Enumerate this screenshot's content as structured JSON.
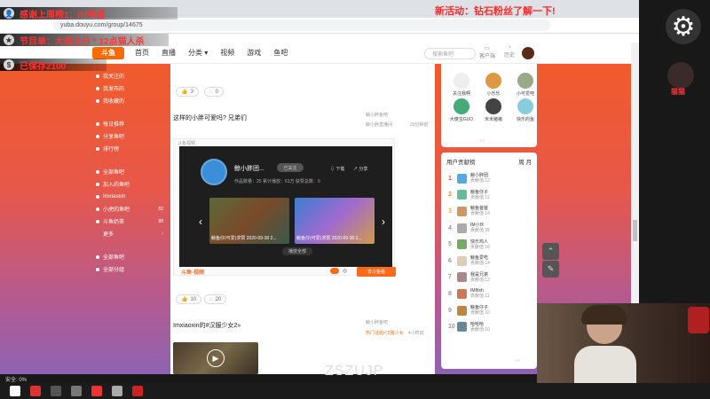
{
  "overlay": {
    "line1": "感谢上周榜1：IM希望",
    "line2": "节目单：大佬上分 * 12点猫人杀",
    "line3": "已保存2100",
    "activity": "新活动：钻石粉丝了解一下!",
    "right_label": "猫猫"
  },
  "browser": {
    "url": "yuba.douyu.com/group/14675"
  },
  "site": {
    "logo": "斗鱼",
    "nav": [
      "首页",
      "直播",
      "分类 ▾",
      "视频",
      "游戏",
      "鱼吧"
    ],
    "search_placeholder": "搜索鱼吧",
    "hdr_icons": [
      "客户端",
      "历史"
    ]
  },
  "leftnav": {
    "items": [
      "我关注的",
      "我发布的",
      "我收藏的"
    ],
    "items2": [
      "每日推荐",
      "分享鱼吧",
      "排行榜"
    ],
    "items3": [
      "全部鱼吧",
      "加入的鱼吧"
    ],
    "sub": [
      {
        "label": "Imxiaoxin",
        "num": ""
      },
      {
        "label": "小虎的鱼吧",
        "num": "82"
      },
      {
        "label": "斗鱼奶茶",
        "num": "88"
      },
      {
        "label": "更多",
        "num": ""
      }
    ],
    "items4": [
      "全部鱼吧",
      "全部分组"
    ]
  },
  "feed": {
    "like_count": "3",
    "comment_count": "0",
    "post1_title": "这样的小胖可爱吗? 兄弟们",
    "post1_meta": "鲸小胖鱼吧",
    "post1_time": "20分钟前",
    "post1_side": "鲸小胖直播间",
    "embed_source": "斗鱼视频",
    "embed_name": "鲸小胖团...",
    "embed_follow": "已关注",
    "embed_stats": "作品数量：25    累计播放：61万    获赞总数：0",
    "embed_act1": "下载",
    "embed_act2": "分享",
    "thumb1_cap": "鲸鱼仔(可爱)求赞 2020-09-30 2...",
    "thumb2_cap": "鲸鱼仔(可爱)求赞 2020-09-30 2...",
    "embed_mid": "播放全部",
    "embed_btn": "去斗鱼看",
    "footer_logo": "斗鱼·视频",
    "like2": "10",
    "comment2": "20",
    "post2_title": "Imxiaoxin的#汉服少女2»",
    "post2_meta": "鲸小胖鱼吧",
    "post2_tag": "热门话题#汉服少女",
    "post2_time": "4小时前"
  },
  "users": [
    {
      "name": "关注我啊",
      "color": "#eee"
    },
    {
      "name": "小乐乐",
      "color": "#d94"
    },
    {
      "name": "小可爱吧",
      "color": "#9a8"
    },
    {
      "name": "大傻宝GUO",
      "color": "#4a7"
    },
    {
      "name": "米米猪猪",
      "color": "#444"
    },
    {
      "name": "快乐的鱼",
      "color": "#8cd"
    }
  ],
  "rank": {
    "title": "用户贡献榜",
    "rows": [
      {
        "num": "1",
        "name": "鲸小胖团",
        "sub": "贡献值 12",
        "color": "#5ad"
      },
      {
        "num": "2",
        "name": "鲸鱼仔子",
        "sub": "贡献值 11",
        "color": "#6b9"
      },
      {
        "num": "3",
        "name": "鲸鱼爸爸",
        "sub": "贡献值 14",
        "color": "#c96"
      },
      {
        "num": "4",
        "name": "IM小伙",
        "sub": "贡献值 25",
        "color": "#aaa"
      },
      {
        "num": "5",
        "name": "快乐鸡人",
        "sub": "贡献值 10",
        "color": "#7a6"
      },
      {
        "num": "6",
        "name": "鲸鱼爱吃",
        "sub": "贡献值 14",
        "color": "#dcb"
      },
      {
        "num": "7",
        "name": "我是兄弟",
        "sub": "贡献值 12",
        "color": "#a88"
      },
      {
        "num": "8",
        "name": "IMIfish",
        "sub": "贡献值 11",
        "color": "#c75"
      },
      {
        "num": "9",
        "name": "鲸鱼仔子",
        "sub": "贡献值 10",
        "color": "#b84"
      },
      {
        "num": "10",
        "name": "哈哈哈",
        "sub": "贡献值 10",
        "color": "#689"
      }
    ]
  },
  "status": "安全: 0%",
  "stream_text": "ZSZUJP"
}
